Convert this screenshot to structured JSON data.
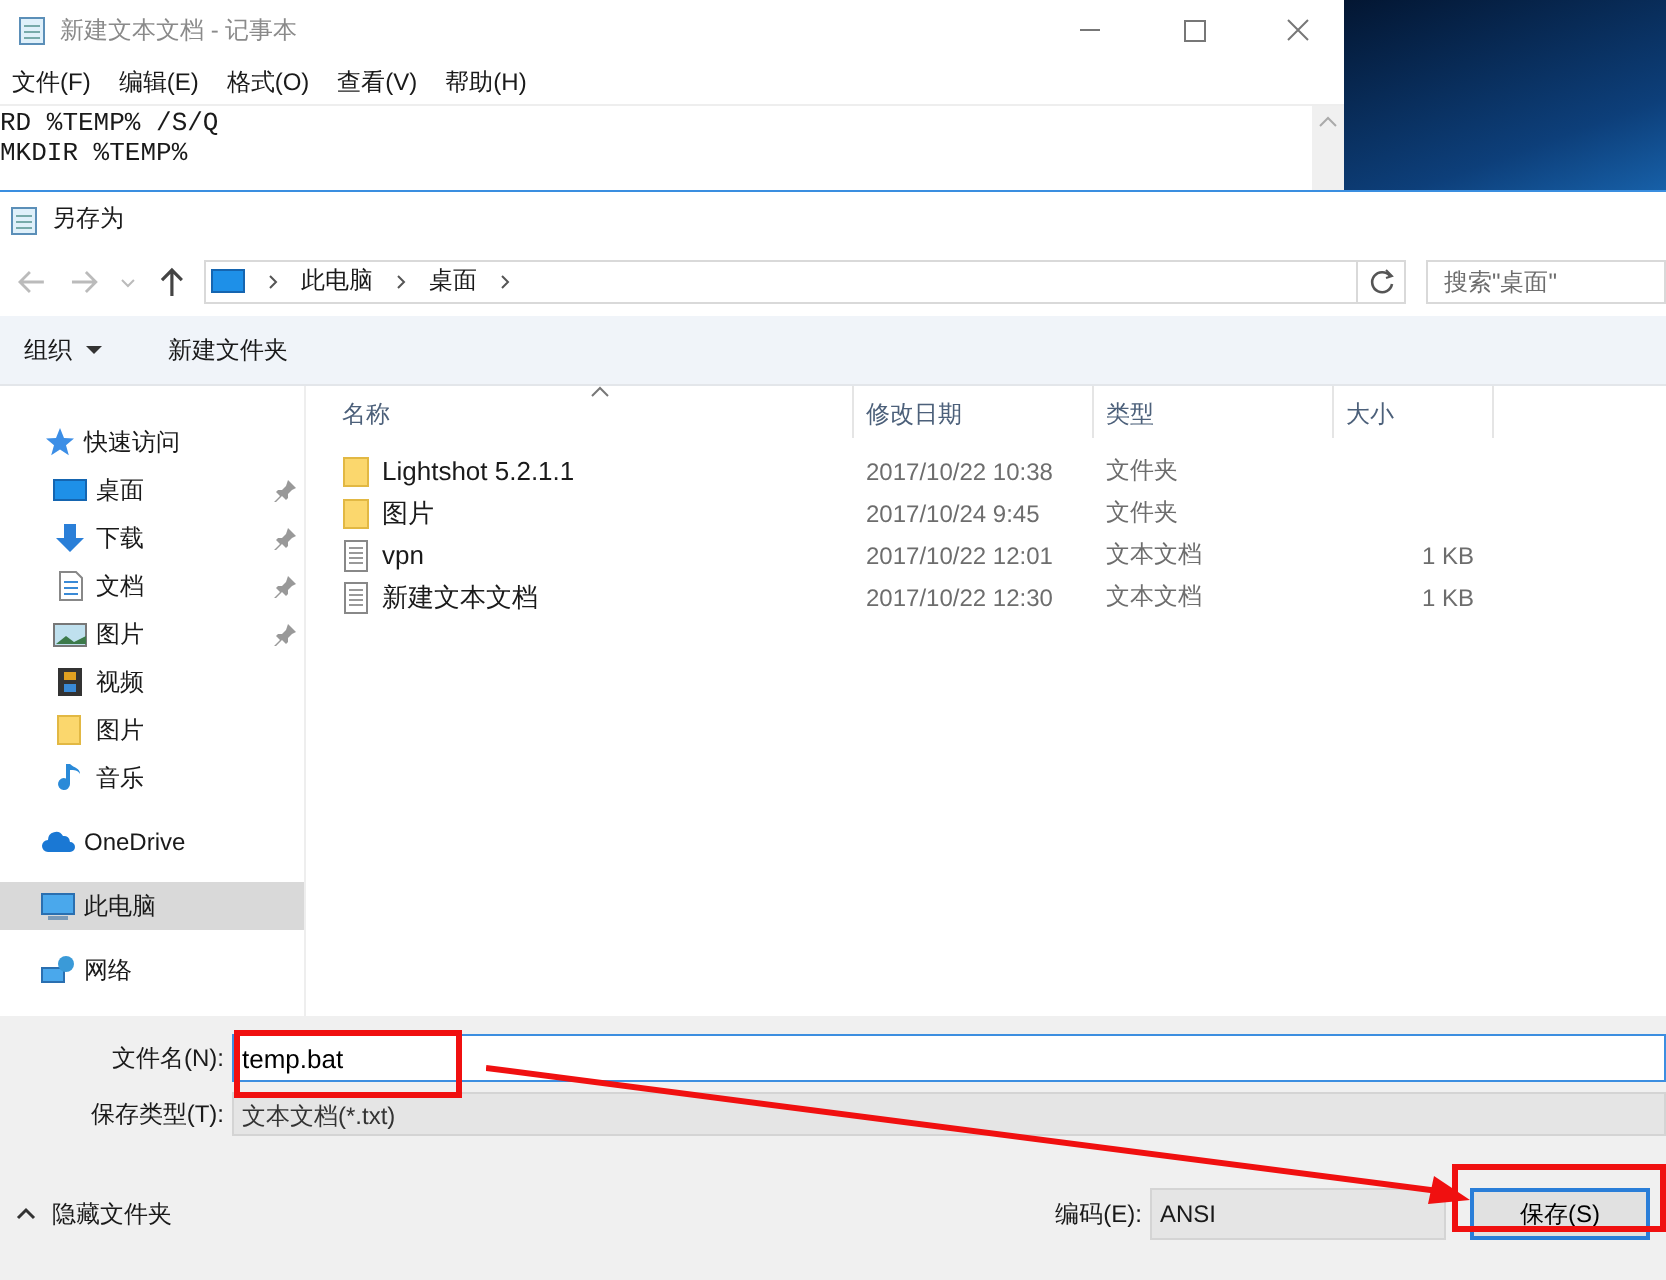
{
  "notepad": {
    "title": "新建文本文档 - 记事本",
    "menu": [
      "文件(F)",
      "编辑(E)",
      "格式(O)",
      "查看(V)",
      "帮助(H)"
    ],
    "lines": [
      "RD %TEMP% /S/Q",
      "MKDIR %TEMP%"
    ]
  },
  "dialog": {
    "title": "另存为",
    "breadcrumb": [
      "此电脑",
      "桌面"
    ],
    "search": {
      "placeholder": "搜索\"桌面\""
    },
    "toolbar": {
      "organize": "组织",
      "new_folder": "新建文件夹"
    },
    "sidebar": [
      {
        "label": "快速访问",
        "kind": "star",
        "selected": false,
        "children": [
          {
            "label": "桌面",
            "kind": "desktop",
            "pinned": true,
            "selected": false
          },
          {
            "label": "下载",
            "kind": "download",
            "pinned": true,
            "selected": false
          },
          {
            "label": "文档",
            "kind": "document",
            "pinned": true,
            "selected": false
          },
          {
            "label": "图片",
            "kind": "pictures",
            "pinned": true,
            "selected": false
          },
          {
            "label": "视频",
            "kind": "video",
            "pinned": false,
            "selected": false
          },
          {
            "label": "图片",
            "kind": "folder",
            "pinned": false,
            "selected": false
          },
          {
            "label": "音乐",
            "kind": "music",
            "pinned": false,
            "selected": false
          }
        ]
      },
      {
        "label": "OneDrive",
        "kind": "cloud",
        "selected": false
      },
      {
        "label": "此电脑",
        "kind": "computer",
        "selected": true
      },
      {
        "label": "网络",
        "kind": "network",
        "selected": false
      }
    ],
    "columns": [
      "名称",
      "修改日期",
      "类型",
      "大小"
    ],
    "files": [
      {
        "name": "Lightshot 5.2.1.1",
        "kind": "folder",
        "modified": "2017/10/22 10:38",
        "type": "文件夹"
      },
      {
        "name": "图片",
        "kind": "folder",
        "modified": "2017/10/24 9:45",
        "type": "文件夹"
      },
      {
        "name": "vpn",
        "kind": "text",
        "modified": "2017/10/22 12:01",
        "type": "文本文档",
        "size": "1 KB"
      },
      {
        "name": "新建文本文档",
        "kind": "text",
        "modified": "2017/10/22 12:30",
        "type": "文本文档",
        "size": "1 KB"
      }
    ],
    "filename": {
      "label": "文件名(N):",
      "value": "temp.bat"
    },
    "filetype": {
      "label": "保存类型(T):",
      "value": "文本文档(*.txt)"
    },
    "hide_folders": "隐藏文件夹",
    "encoding": {
      "label": "编码(E):",
      "value": "ANSI"
    },
    "save_button": "保存(S)"
  }
}
